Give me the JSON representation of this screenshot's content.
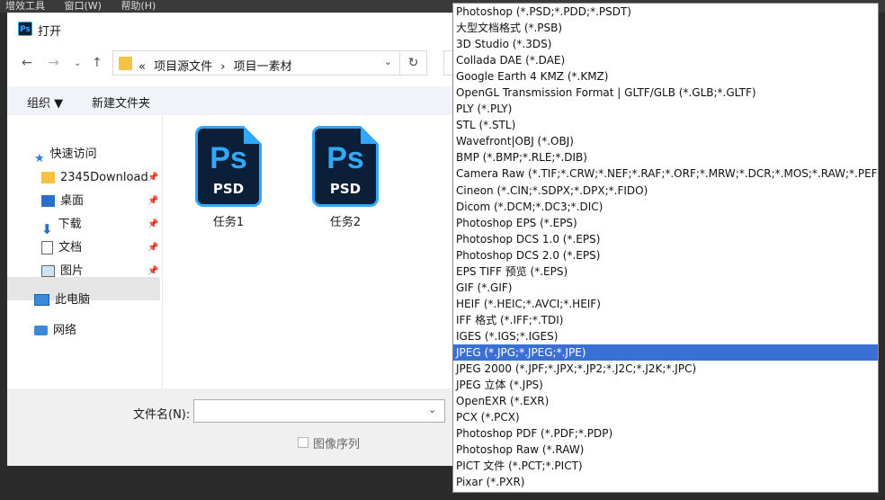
{
  "app_menu": {
    "items": [
      "增效工具",
      "窗口(W)",
      "帮助(H)"
    ]
  },
  "dialog": {
    "title": "打开",
    "icon_text": "Ps",
    "path": [
      "«",
      "项目源文件",
      "›",
      "项目一素材"
    ],
    "toolbar": {
      "organize": "组织 ▼",
      "new_folder": "新建文件夹"
    },
    "sidebar": [
      {
        "label": "快速访问",
        "icon": "star-icon",
        "pinned": false
      },
      {
        "label": "2345Download",
        "icon": "folder-icon",
        "pinned": true
      },
      {
        "label": "桌面",
        "icon": "desktop-icon",
        "pinned": true
      },
      {
        "label": "下载",
        "icon": "download-icon",
        "pinned": true
      },
      {
        "label": "文档",
        "icon": "document-icon",
        "pinned": true
      },
      {
        "label": "图片",
        "icon": "picture-icon",
        "pinned": true
      },
      {
        "label": "此电脑",
        "icon": "computer-icon",
        "pinned": false,
        "selected": true
      },
      {
        "label": "网络",
        "icon": "network-icon",
        "pinned": false
      }
    ],
    "files": [
      {
        "name": "任务1",
        "icon_top": "Ps",
        "icon_bottom": "PSD"
      },
      {
        "name": "任务2",
        "icon_top": "Ps",
        "icon_bottom": "PSD"
      }
    ],
    "filename_label": "文件名(N):",
    "filename_value": "",
    "image_sequence_label": "图像序列"
  },
  "format_list": {
    "selected_index": 21,
    "items": [
      "Photoshop (*.PSD;*.PDD;*.PSDT)",
      "大型文档格式 (*.PSB)",
      "3D Studio (*.3DS)",
      "Collada DAE (*.DAE)",
      "Google Earth 4 KMZ (*.KMZ)",
      "OpenGL Transmission Format | GLTF/GLB (*.GLB;*.GLTF)",
      "PLY (*.PLY)",
      "STL (*.STL)",
      "Wavefront|OBJ (*.OBJ)",
      "BMP (*.BMP;*.RLE;*.DIB)",
      "Camera Raw (*.TIF;*.CRW;*.NEF;*.RAF;*.ORF;*.MRW;*.DCR;*.MOS;*.RAW;*.PEF;*",
      "Cineon (*.CIN;*.SDPX;*.DPX;*.FIDO)",
      "Dicom (*.DCM;*.DC3;*.DIC)",
      "Photoshop EPS (*.EPS)",
      "Photoshop DCS 1.0 (*.EPS)",
      "Photoshop DCS 2.0 (*.EPS)",
      "EPS TIFF 预览 (*.EPS)",
      "GIF (*.GIF)",
      "HEIF (*.HEIC;*.AVCI;*.HEIF)",
      "IFF 格式 (*.IFF;*.TDI)",
      "IGES (*.IGS;*.IGES)",
      "JPEG (*.JPG;*.JPEG;*.JPE)",
      "JPEG 2000 (*.JPF;*.JPX;*.JP2;*.J2C;*.J2K;*.JPC)",
      "JPEG 立体 (*.JPS)",
      "OpenEXR (*.EXR)",
      "PCX (*.PCX)",
      "Photoshop PDF (*.PDF;*.PDP)",
      "Photoshop Raw (*.RAW)",
      "PICT 文件 (*.PCT;*.PICT)",
      "Pixar (*.PXR)"
    ]
  },
  "colors": {
    "selection": "#3a6fd6",
    "ps_blue": "#31a8ff",
    "ps_dark": "#0b2038"
  }
}
